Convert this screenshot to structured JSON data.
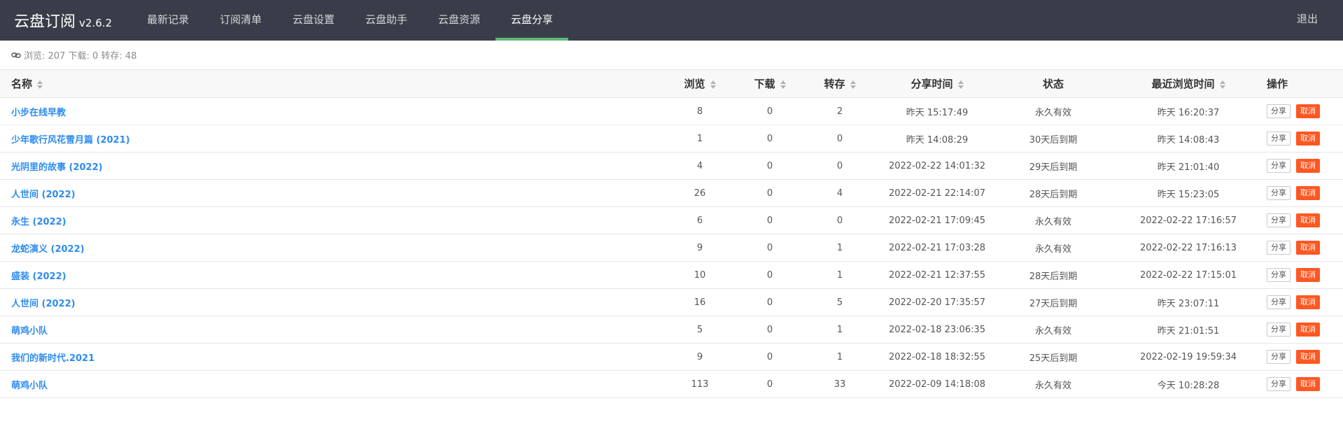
{
  "app": {
    "name": "云盘订阅",
    "version": "v2.6.2"
  },
  "nav": {
    "items": [
      {
        "label": "最新记录"
      },
      {
        "label": "订阅清单"
      },
      {
        "label": "云盘设置"
      },
      {
        "label": "云盘助手"
      },
      {
        "label": "云盘资源"
      },
      {
        "label": "云盘分享"
      }
    ],
    "active_index": 5,
    "logout_label": "退出"
  },
  "stats": {
    "icon": "link-icon",
    "text": "浏览: 207 下载: 0 转存: 48"
  },
  "table": {
    "headers": {
      "name": "名称",
      "views": "浏览",
      "downloads": "下载",
      "saves": "转存",
      "share_time": "分享时间",
      "status": "状态",
      "last_view": "最近浏览时间",
      "ops": "操作"
    },
    "share_label": "分享",
    "cancel_label": "取消",
    "rows": [
      {
        "name": "小步在线早教",
        "views": "8",
        "downloads": "0",
        "saves": "2",
        "share_time": "昨天 15:17:49",
        "status": "永久有效",
        "last_view": "昨天 16:20:37"
      },
      {
        "name": "少年歌行风花雪月篇 (2021)",
        "views": "1",
        "downloads": "0",
        "saves": "0",
        "share_time": "昨天 14:08:29",
        "status": "30天后到期",
        "last_view": "昨天 14:08:43"
      },
      {
        "name": "光阴里的故事 (2022)",
        "views": "4",
        "downloads": "0",
        "saves": "0",
        "share_time": "2022-02-22 14:01:32",
        "status": "29天后到期",
        "last_view": "昨天 21:01:40"
      },
      {
        "name": "人世间 (2022)",
        "views": "26",
        "downloads": "0",
        "saves": "4",
        "share_time": "2022-02-21 22:14:07",
        "status": "28天后到期",
        "last_view": "昨天 15:23:05"
      },
      {
        "name": "永生 (2022)",
        "views": "6",
        "downloads": "0",
        "saves": "0",
        "share_time": "2022-02-21 17:09:45",
        "status": "永久有效",
        "last_view": "2022-02-22 17:16:57"
      },
      {
        "name": "龙蛇演义 (2022)",
        "views": "9",
        "downloads": "0",
        "saves": "1",
        "share_time": "2022-02-21 17:03:28",
        "status": "永久有效",
        "last_view": "2022-02-22 17:16:13"
      },
      {
        "name": "盛装 (2022)",
        "views": "10",
        "downloads": "0",
        "saves": "1",
        "share_time": "2022-02-21 12:37:55",
        "status": "28天后到期",
        "last_view": "2022-02-22 17:15:01"
      },
      {
        "name": "人世间 (2022)",
        "views": "16",
        "downloads": "0",
        "saves": "5",
        "share_time": "2022-02-20 17:35:57",
        "status": "27天后到期",
        "last_view": "昨天 23:07:11"
      },
      {
        "name": "萌鸡小队",
        "views": "5",
        "downloads": "0",
        "saves": "1",
        "share_time": "2022-02-18 23:06:35",
        "status": "永久有效",
        "last_view": "昨天 21:01:51"
      },
      {
        "name": "我们的新时代.2021",
        "views": "9",
        "downloads": "0",
        "saves": "1",
        "share_time": "2022-02-18 18:32:55",
        "status": "25天后到期",
        "last_view": "2022-02-19 19:59:34"
      },
      {
        "name": "萌鸡小队",
        "views": "113",
        "downloads": "0",
        "saves": "33",
        "share_time": "2022-02-09 14:18:08",
        "status": "永久有效",
        "last_view": "今天 10:28:28"
      }
    ]
  },
  "colors": {
    "topbar_bg": "#393d49",
    "active_indicator": "#5fb878",
    "link": "#2d8cf0",
    "cancel_button": "#ff5722"
  }
}
